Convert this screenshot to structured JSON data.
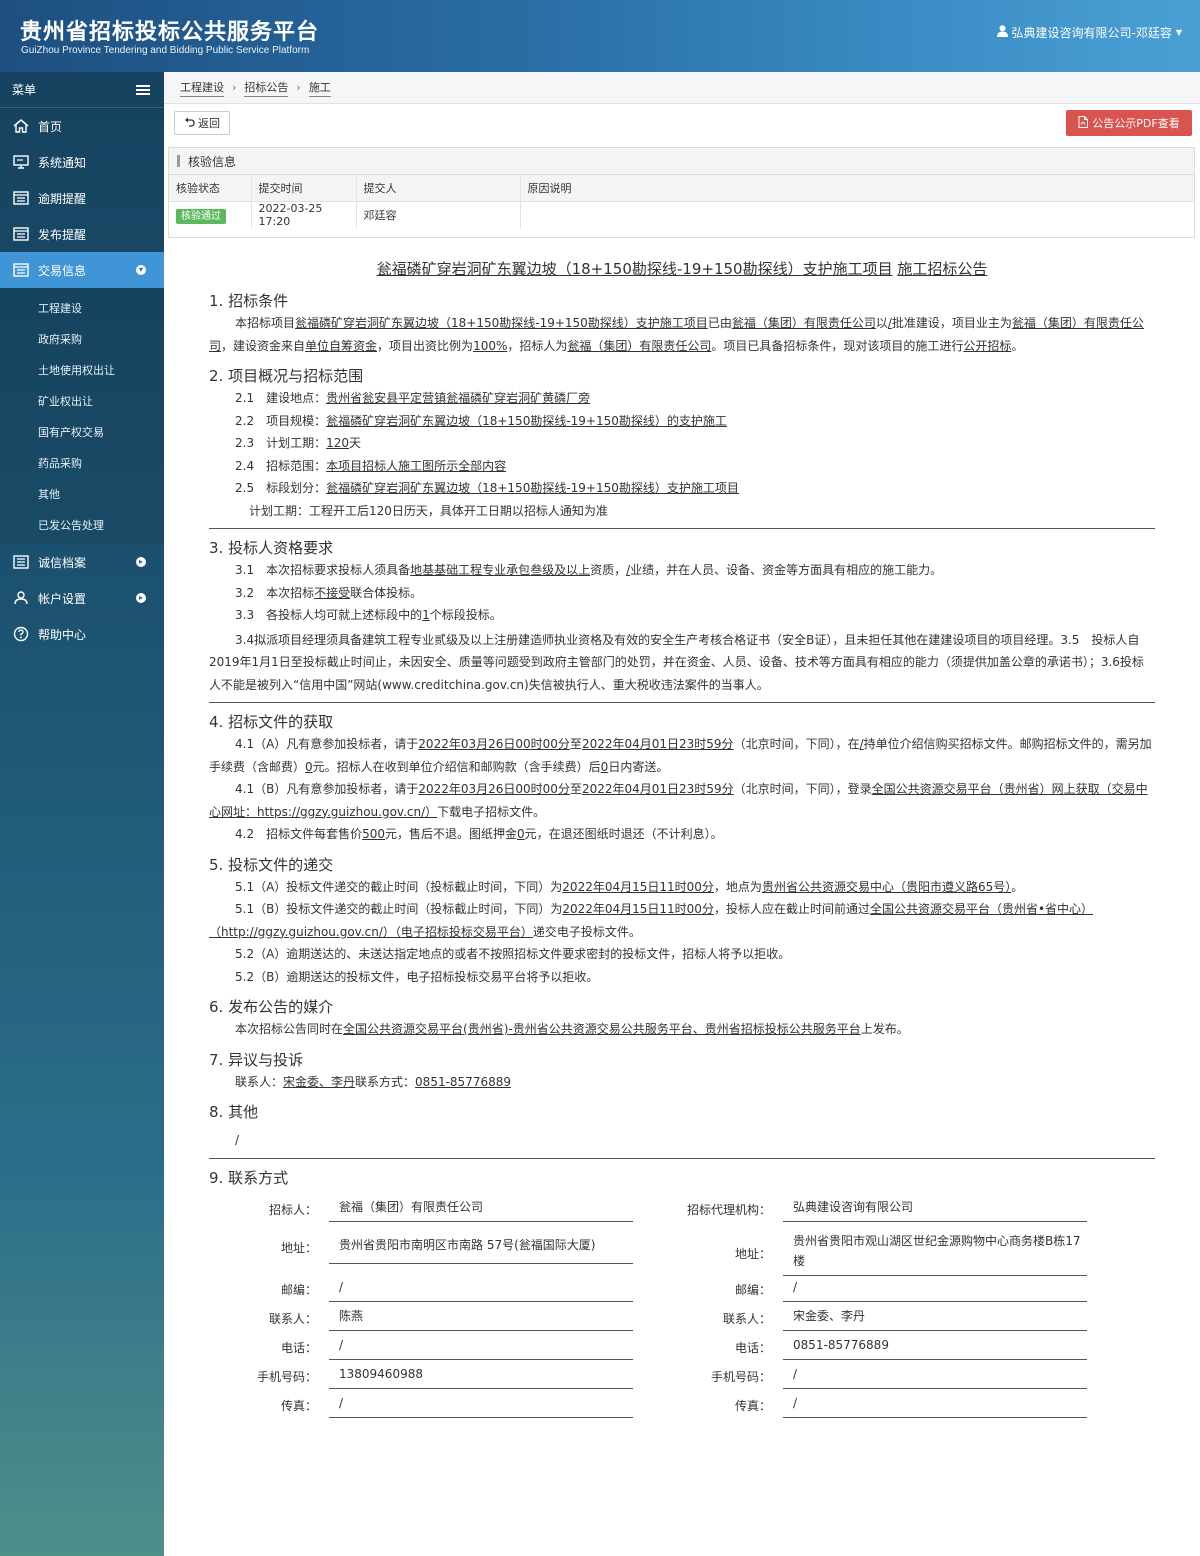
{
  "header": {
    "title_cn": "贵州省招标投标公共服务平台",
    "title_en": "GuiZhou Province Tendering and Bidding Public Service Platform",
    "user": "弘典建设咨询有限公司-邓廷容"
  },
  "sidebar": {
    "menu_label": "菜单",
    "items": [
      {
        "label": "首页"
      },
      {
        "label": "系统通知"
      },
      {
        "label": "逾期提醒"
      },
      {
        "label": "发布提醒"
      },
      {
        "label": "交易信息"
      },
      {
        "label": "诚信档案"
      },
      {
        "label": "帐户设置"
      },
      {
        "label": "帮助中心"
      }
    ],
    "sub_items": [
      {
        "label": "工程建设"
      },
      {
        "label": "政府采购"
      },
      {
        "label": "土地使用权出让"
      },
      {
        "label": "矿业权出让"
      },
      {
        "label": "国有产权交易"
      },
      {
        "label": "药品采购"
      },
      {
        "label": "其他"
      },
      {
        "label": "已发公告处理"
      }
    ]
  },
  "breadcrumb": [
    "工程建设",
    "招标公告",
    "施工"
  ],
  "toolbar": {
    "back_label": "返回",
    "pdf_label": "公告公示PDF查看"
  },
  "check_panel": {
    "title": "核验信息",
    "headers": [
      "核验状态",
      "提交时间",
      "提交人",
      "原因说明"
    ],
    "row": {
      "status": "核验通过",
      "time": "2022-03-25 17:20",
      "submitter": "邓廷容",
      "reason": ""
    }
  },
  "doc": {
    "title_project": "瓮福磷矿穿岩洞矿东翼边坡（18+150勘探线-19+150勘探线）支护施工项目",
    "title_suffix": "施工招标公告",
    "s1": {
      "heading": "1. 招标条件",
      "t1": "本招标项目",
      "project": "瓮福磷矿穿岩洞矿东翼边坡（18+150勘探线-19+150勘探线）支护施工项目",
      "t2": "已由",
      "approver": "瓮福（集团）有限责任公司",
      "t3": "以",
      "doc_no": "/",
      "t4": "批准建设，项目业主为",
      "owner": "瓮福（集团）有限责任公司",
      "t5": "，建设资金来自",
      "fund": "单位自筹资金",
      "t6": "，项目出资比例为",
      "ratio": "100%",
      "t7": "，招标人为",
      "tenderer": "瓮福（集团）有限责任公司",
      "t8": "。项目已具备招标条件，现对该项目的施工进行",
      "method": "公开招标",
      "t9": "。"
    },
    "s2": {
      "heading": "2. 项目概况与招标范围",
      "l1_label": "2.1　建设地点：",
      "l1_val": "贵州省瓮安县平定营镇瓮福磷矿穿岩洞矿黄磷厂旁",
      "l2_label": "2.2　项目规模：",
      "l2_val": "瓮福磷矿穿岩洞矿东翼边坡（18+150勘探线-19+150勘探线）的支护施工",
      "l3_label": "2.3　计划工期：",
      "l3_val": "120",
      "l3_unit": "天",
      "l4_label": "2.4　招标范围：",
      "l4_val": "本项目招标人施工图所示全部内容",
      "l5_label": "2.5　标段划分：",
      "l5_val": "瓮福磷矿穿岩洞矿东翼边坡（18+150勘探线-19+150勘探线）支护施工项目",
      "note": "计划工期：工程开工后120日历天，具体开工日期以招标人通知为准"
    },
    "s3": {
      "heading": "3. 投标人资格要求",
      "l1_a": "3.1　本次招标要求投标人须具备",
      "l1_qual": "地基基础工程专业承包叁级及以上",
      "l1_b": "资质，",
      "l1_perf": "/",
      "l1_c": "业绩，并在人员、设备、资金等方面具有相应的施工能力。",
      "l2_a": "3.2　本次招标",
      "l2_val": "不接受",
      "l2_b": "联合体投标。",
      "l3_a": "3.3　各投标人均可就上述标段中的",
      "l3_val": "1",
      "l3_b": "个标段投标。",
      "para": "3.4拟派项目经理须具备建筑工程专业贰级及以上注册建造师执业资格及有效的安全生产考核合格证书（安全B证），且未担任其他在建建设项目的项目经理。3.5　投标人自2019年1月1日至投标截止时间止，未因安全、质量等问题受到政府主管部门的处罚，并在资金、人员、设备、技术等方面具有相应的能力（须提供加盖公章的承诺书）；3.6投标人不能是被列入“信用中国”网站(www.creditchina.gov.cn)失信被执行人、重大税收违法案件的当事人。"
    },
    "s4": {
      "heading": "4. 招标文件的获取",
      "a1": "4.1（A）凡有意参加投标者，请于",
      "a_start": "2022年03月26日00时00分",
      "a2": "至",
      "a_end": "2022年04月01日23时59分",
      "a3": "（北京时间，下同），在",
      "a_place": "/",
      "a4": "持单位介绍信购买招标文件。邮购招标文件的，需另加手续费（含邮费）",
      "a_fee": "0",
      "a5": "元。招标人在收到单位介绍信和邮购款（含手续费）后",
      "a_days": "0",
      "a6": "日内寄送。",
      "b1": "4.1（B）凡有意参加投标者，请于",
      "b_start": "2022年03月26日00时00分",
      "b2": "至",
      "b_end": "2022年04月01日23时59分",
      "b3": "（北京时间，下同），登录",
      "b_site": "全国公共资源交易平台（贵州省）网上获取（交易中心网址：https://ggzy.guizhou.gov.cn/）",
      "b4": "下载电子招标文件。",
      "c1": "4.2　招标文件每套售价",
      "c_price": "500",
      "c2": "元，售后不退。图纸押金",
      "c_deposit": "0",
      "c3": "元，在退还图纸时退还（不计利息）。"
    },
    "s5": {
      "heading": "5. 投标文件的递交",
      "a1": "5.1（A）投标文件递交的截止时间（投标截止时间，下同）为",
      "a_time": "2022年04月15日11时00分",
      "a2": "，地点为",
      "a_place": "贵州省公共资源交易中心（贵阳市遵义路65号）",
      "a3": "。",
      "b1": "5.1（B）投标文件递交的截止时间（投标截止时间，下同）为",
      "b_time": "2022年04月15日11时00分",
      "b2": "，投标人应在截止时间前通过",
      "b_site": "全国公共资源交易平台（贵州省•省中心）（http://ggzy.guizhou.gov.cn/）（电子招标投标交易平台）",
      "b3": "递交电子投标文件。",
      "c": "5.2（A）逾期送达的、未送达指定地点的或者不按照招标文件要求密封的投标文件，招标人将予以拒收。",
      "d": "5.2（B）逾期送达的投标文件，电子招标投标交易平台将予以拒收。"
    },
    "s6": {
      "heading": "6. 发布公告的媒介",
      "t1": "本次招标公告同时在",
      "media": "全国公共资源交易平台(贵州省)-贵州省公共资源交易公共服务平台、贵州省招标投标公共服务平台",
      "t2": "上发布。"
    },
    "s7": {
      "heading": "7. 异议与投诉",
      "t1": "联系人：",
      "person": "宋金委、李丹",
      "t2": "联系方式：",
      "phone": "0851-85776889"
    },
    "s8": {
      "heading": "8. 其他",
      "content": "/"
    },
    "s9": {
      "heading": "9. 联系方式",
      "left": [
        {
          "label": "招标人：",
          "value": "瓮福（集团）有限责任公司"
        },
        {
          "label": "地址：",
          "value": "贵州省贵阳市南明区市南路 57号(瓮福国际大厦)"
        },
        {
          "label": "邮编：",
          "value": "/"
        },
        {
          "label": "联系人：",
          "value": "陈燕"
        },
        {
          "label": "电话：",
          "value": "/"
        },
        {
          "label": "手机号码：",
          "value": "13809460988"
        },
        {
          "label": "传真：",
          "value": "/"
        }
      ],
      "right": [
        {
          "label": "招标代理机构：",
          "value": "弘典建设咨询有限公司"
        },
        {
          "label": "地址：",
          "value": "贵州省贵阳市观山湖区世纪金源购物中心商务楼B栋17楼"
        },
        {
          "label": "邮编：",
          "value": "/"
        },
        {
          "label": "联系人：",
          "value": "宋金委、李丹"
        },
        {
          "label": "电话：",
          "value": "0851-85776889"
        },
        {
          "label": "手机号码：",
          "value": "/"
        },
        {
          "label": "传真：",
          "value": "/"
        }
      ]
    }
  }
}
